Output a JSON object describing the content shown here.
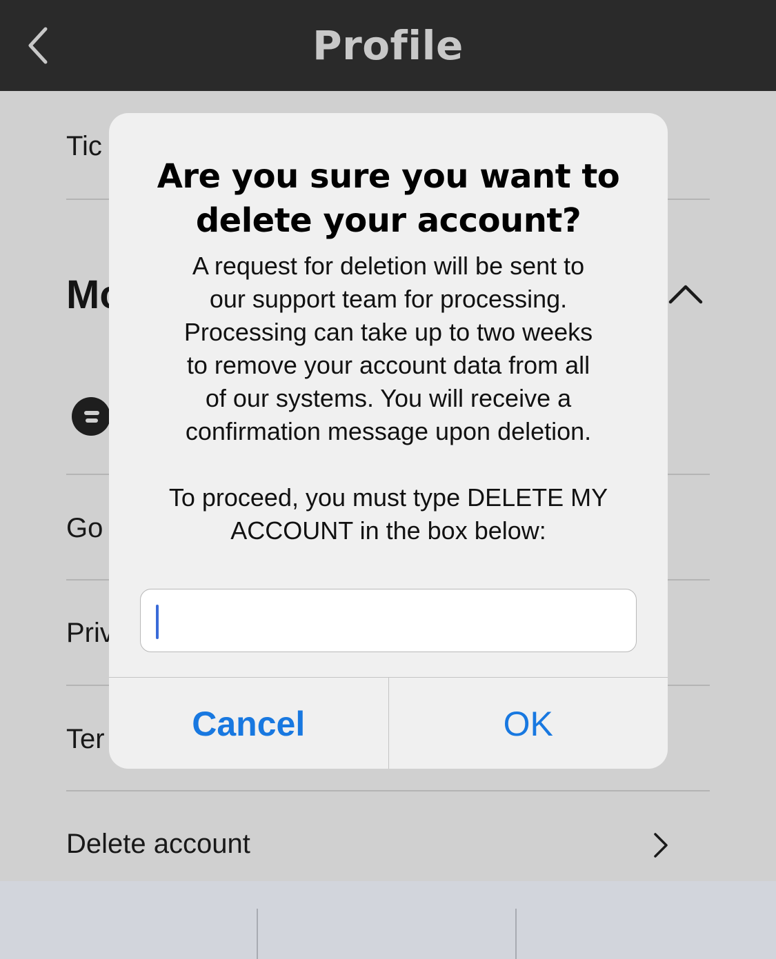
{
  "navbar": {
    "title": "Profile",
    "back_icon": "chevron-left-icon"
  },
  "list": {
    "rows": [
      {
        "label": "Tic"
      },
      {
        "label": "Go"
      },
      {
        "label": "Priv"
      },
      {
        "label": "Ter"
      },
      {
        "label": "Delete account"
      }
    ],
    "section_title": "Mo",
    "collapse_icon": "chevron-up-icon",
    "brand_icon": "brand-logo-icon",
    "row_icon": "chevron-right-icon"
  },
  "dialog": {
    "title": "Are you sure you want to delete your account?",
    "message": "A request for deletion will be sent to\nour support team for processing.\nProcessing can take up to two weeks\nto remove your account data from all\nof our systems. You will receive a\nconfirmation message upon deletion.\n\nTo proceed, you must type DELETE MY\nACCOUNT in the box below:",
    "input_value": "",
    "cancel_label": "Cancel",
    "ok_label": "OK",
    "accent_color": "#1878e0"
  }
}
